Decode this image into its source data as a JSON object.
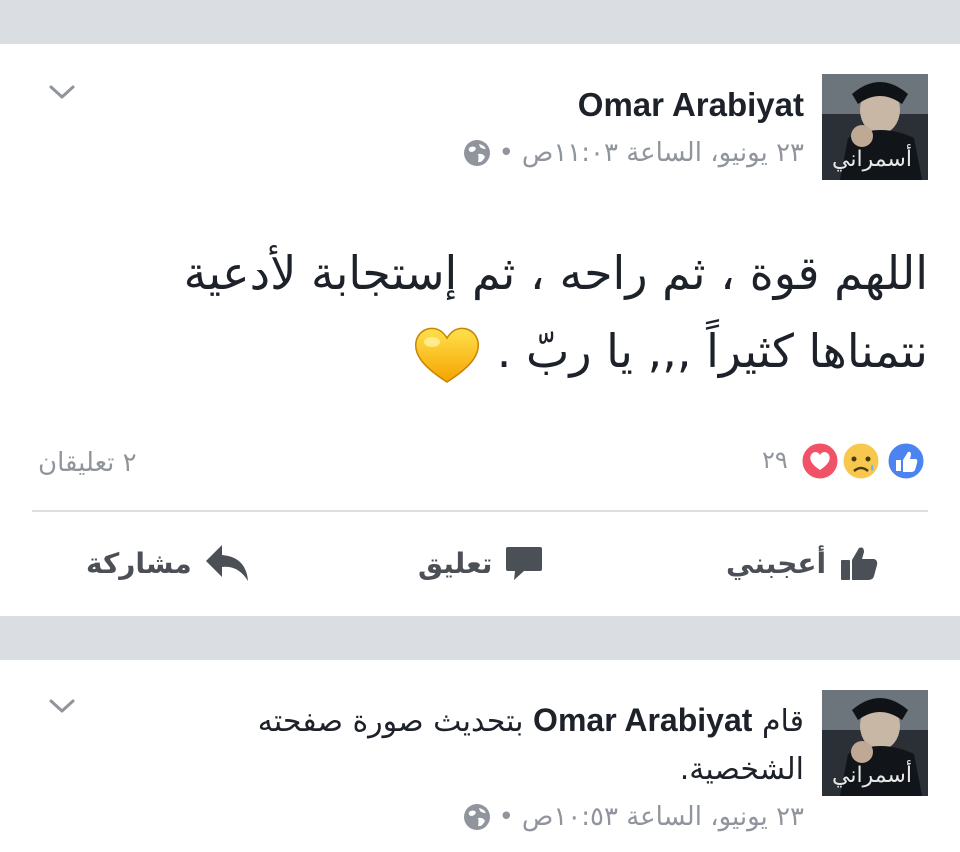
{
  "post": {
    "author": "Omar Arabiyat",
    "time": "٢٣ يونيو، الساعة ١١:٠٣ص",
    "separator": "•",
    "text_line1": "اللهم قوة ، ثم راحه ، ثم إستجابة لأدعية",
    "text_line2": "نتمناها كثيراً ,,, يا ربّ .",
    "reaction_count": "٢٩",
    "comments_count": "٢ تعليقان",
    "actions": {
      "like": "أعجبني",
      "comment": "تعليق",
      "share": "مشاركة"
    },
    "reactions": [
      "like",
      "sad",
      "love"
    ]
  },
  "post2": {
    "prefix": "قام",
    "author": "Omar Arabiyat",
    "suffix": "بتحديث صورة صفحته الشخصية.",
    "time": "٢٣ يونيو، الساعة ١٠:٥٣ص",
    "separator": "•"
  },
  "avatar_caption": "أسمراني"
}
